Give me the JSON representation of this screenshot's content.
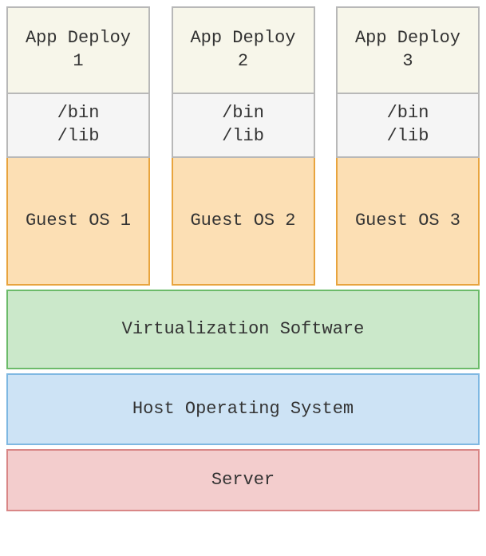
{
  "vms": [
    {
      "app": "App Deploy\n1",
      "bin": "/bin\n/lib",
      "guest": "Guest OS 1"
    },
    {
      "app": "App Deploy\n2",
      "bin": "/bin\n/lib",
      "guest": "Guest OS 2"
    },
    {
      "app": "App Deploy\n3",
      "bin": "/bin\n/lib",
      "guest": "Guest OS 3"
    }
  ],
  "layers": {
    "virtualization": "Virtualization Software",
    "host_os": "Host Operating System",
    "server": "Server"
  }
}
